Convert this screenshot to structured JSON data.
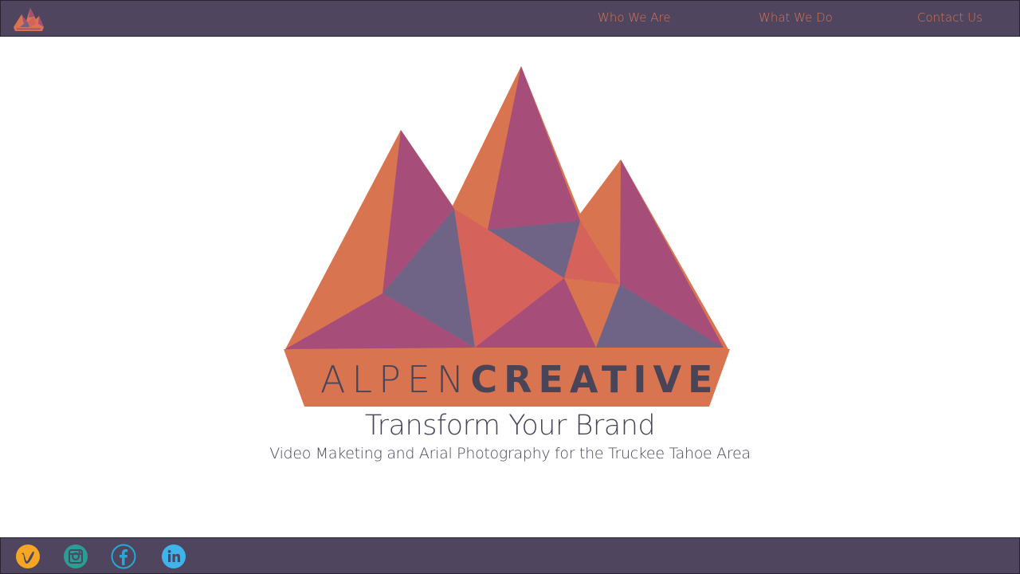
{
  "header": {
    "logo_icon": "alpen-creative-logo",
    "nav": [
      {
        "label": "Who We Are"
      },
      {
        "label": "What We Do"
      },
      {
        "label": "Contact Us"
      }
    ]
  },
  "hero": {
    "logo_word_light": "ALPEN",
    "logo_word_bold": "CREATIVE",
    "tagline": "Transform Your Brand",
    "subtagline": "Video Maketing and Arial Photography for the Truckee Tahoe Area"
  },
  "footer": {
    "social": [
      {
        "icon": "vimeo-icon",
        "color": "#f5a623"
      },
      {
        "icon": "instagram-icon",
        "color": "#2b9d96"
      },
      {
        "icon": "facebook-icon",
        "color": "#25a7d8"
      },
      {
        "icon": "linkedin-icon",
        "color": "#3fb4ea"
      }
    ]
  },
  "colors": {
    "bar": "#4f455e",
    "accent_orange": "#d8744f",
    "magenta": "#a64d79",
    "slate": "#6f6386",
    "coral": "#d6625c",
    "text_dark": "#4a4458"
  }
}
